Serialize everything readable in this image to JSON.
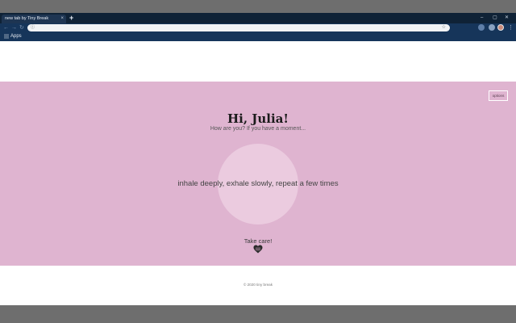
{
  "browser": {
    "tab_title": "new tab by Tiny Break",
    "tab_close": "×",
    "new_tab": "+",
    "window_minimize": "–",
    "window_maximize": "▢",
    "window_close": "✕",
    "nav_back": "←",
    "nav_forward": "→",
    "nav_reload": "↻",
    "omnibox_icon": "info-icon",
    "omnibox_star": "☆",
    "bookmarks": {
      "apps_label": "Apps"
    }
  },
  "page": {
    "options_label": "options",
    "greeting": "Hi, Julia!",
    "subtitle": "How are you? If you have a moment...",
    "instruction": "inhale deeply, exhale slowly, repeat a few times",
    "takecare": "Take care!",
    "footer": "© 2020 tiny break"
  },
  "colors": {
    "hero_bg": "#dfb4d0",
    "circle": "#ebcbdf",
    "chrome_dark": "#0f2236",
    "chrome_toolbar": "#16355a"
  }
}
